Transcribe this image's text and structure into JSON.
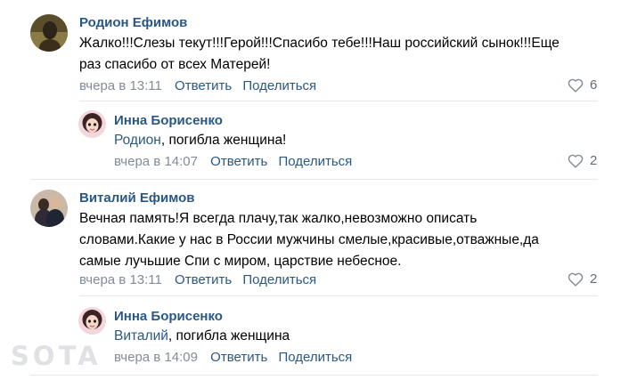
{
  "comments": [
    {
      "author": "Родион Ефимов",
      "text_line1": "Жалко!!!Слезы текут!!!Герой!!!Спасибо тебе!!!Наш российский сынок!!!Еще",
      "text_line2": "раз спасибо от всех Матерей!",
      "date": "вчера в 13:11",
      "reply_label": "Ответить",
      "share_label": "Поделиться",
      "likes": "6",
      "avatar_color": "#6b5a2d",
      "reply": {
        "author": "Инна Борисенко",
        "mention": "Родион",
        "text": ", погибла женщина!",
        "date": "вчера в 14:07",
        "reply_label": "Ответить",
        "share_label": "Поделиться",
        "likes": "2"
      }
    },
    {
      "author": "Виталий Ефимов",
      "text_line1": "Вечная память!Я всегда плачу,так жалко,невозможно описать",
      "text_line2": "словами.Какие у нас в России мужчины смелые,красивые,отважные,да",
      "text_line3": "самые лучьшие Спи с миром, царствие небесное.",
      "date": "вчера в 13:11",
      "reply_label": "Ответить",
      "share_label": "Поделиться",
      "likes": "2",
      "reply": {
        "author": "Инна Борисенко",
        "mention": "Виталий",
        "text": ", погибла женщина",
        "date": "вчера в 14:09",
        "reply_label": "Ответить",
        "share_label": "Поделиться"
      }
    }
  ],
  "watermark": "SOTA",
  "colors": {
    "link": "#2a5885",
    "meta": "#818c99",
    "divider": "#e7e8ec"
  }
}
